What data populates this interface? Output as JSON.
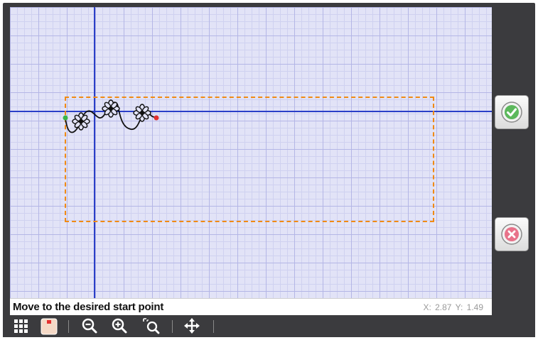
{
  "status": {
    "message": "Move to the desired start point",
    "x_label": "X:",
    "x_value": "2.87",
    "y_label": "Y:",
    "y_value": "1.49"
  },
  "side_buttons": {
    "accept": "accept-check-icon",
    "cancel": "cancel-x-icon"
  },
  "toolbar": [
    "grid-icon",
    "pattern-thumbnail-icon",
    "zoom-out-icon",
    "zoom-in-icon",
    "zoom-fit-icon",
    "move-icon"
  ],
  "colors": {
    "grid_background": "#e2e3f7",
    "crosshair": "#2a3fc8",
    "boundary": "#f08a14",
    "start_point": "#3bb54a",
    "end_point": "#e03030",
    "accept": "#5cb85c",
    "cancel": "#e8728a"
  }
}
